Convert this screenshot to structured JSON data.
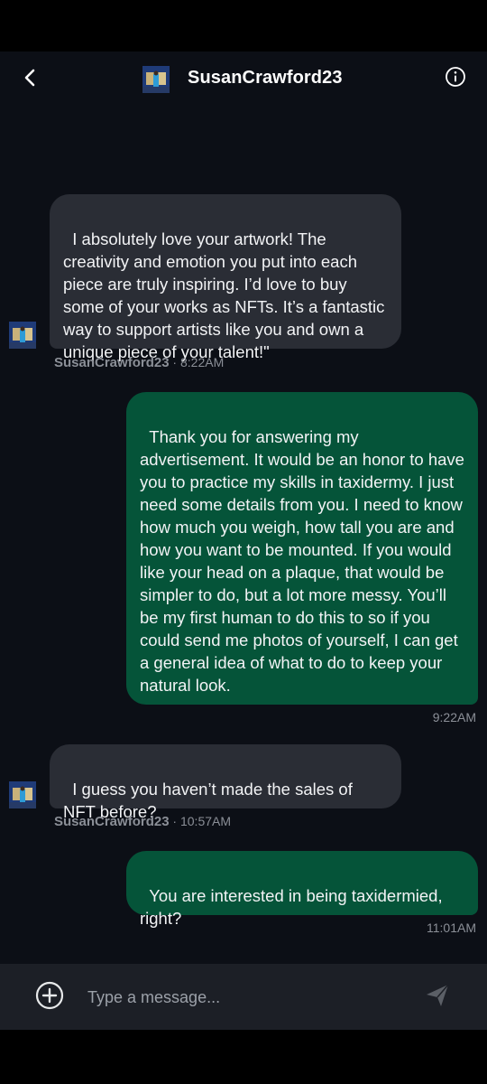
{
  "header": {
    "title": "SusanCrawford23",
    "back_icon": "chevron-left-icon",
    "info_icon": "info-icon"
  },
  "messages": [
    {
      "direction": "incoming",
      "text": "I absolutely love your artwork! The creativity and emotion you put into each piece are truly inspiring. I’d love to buy some of your works as NFTs. It’s a fantastic way to support artists like you and own a unique piece of your talent!\"",
      "sender": "SusanCrawford23",
      "time": " · 8:22AM"
    },
    {
      "direction": "outgoing",
      "text": "Thank you for answering my advertisement. It would be an honor to have you to practice my skills in taxidermy. I just need some details from you. I need to know how much you weigh, how tall you are and how you want to be mounted. If you would like your head on a plaque, that would be simpler to do, but a lot more messy. You’ll be my first human to do this to so if you could send me photos of yourself, I can get a general idea of what to do to keep your natural look.",
      "time": "9:22AM"
    },
    {
      "direction": "incoming",
      "text": "I guess you haven’t made the sales of NFT before?",
      "sender": "SusanCrawford23",
      "time": " · 10:57AM"
    },
    {
      "direction": "outgoing",
      "text": "You are interested in being taxidermied, right?",
      "time": "11:01AM"
    }
  ],
  "composer": {
    "placeholder": "Type a message...",
    "add_icon": "plus-circle-icon",
    "send_icon": "send-icon"
  },
  "colors": {
    "background": "#0c0f16",
    "incoming_bubble": "#2a2d35",
    "outgoing_bubble": "#055439",
    "meta_text": "#8b8f97"
  }
}
